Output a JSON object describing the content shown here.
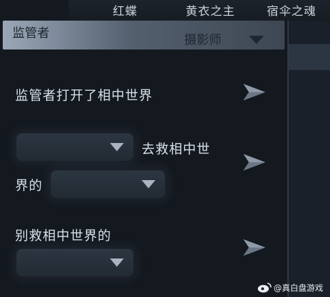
{
  "tabs": [
    "红蝶",
    "黄衣之主",
    "宿伞之魂"
  ],
  "role_header": {
    "title": "监管者",
    "selected": "摄影师"
  },
  "messages": [
    {
      "text": "监管者打开了相中世界"
    },
    {
      "text_a": "去救相中世",
      "text_b": "界的",
      "dropdown_1": "",
      "dropdown_2": ""
    },
    {
      "text": "别救相中世界的",
      "dropdown": ""
    }
  ],
  "watermark": "@真白盘游戏"
}
